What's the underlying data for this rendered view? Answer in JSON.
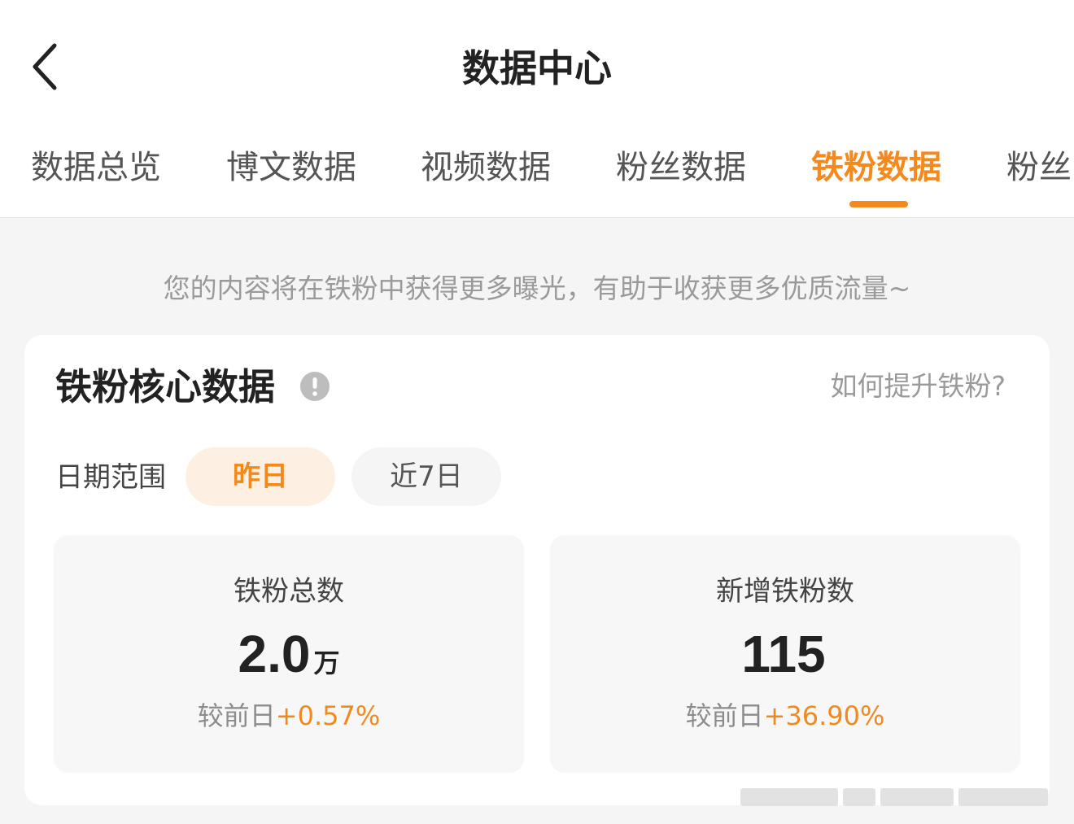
{
  "header": {
    "title": "数据中心",
    "back_icon": "chevron-left-icon"
  },
  "tabs": [
    {
      "label": "数据总览",
      "active": false
    },
    {
      "label": "博文数据",
      "active": false
    },
    {
      "label": "视频数据",
      "active": false
    },
    {
      "label": "粉丝数据",
      "active": false
    },
    {
      "label": "铁粉数据",
      "active": true
    },
    {
      "label": "粉丝",
      "active": false
    }
  ],
  "tip": "您的内容将在铁粉中获得更多曝光，有助于收获更多优质流量~",
  "card": {
    "title": "铁粉核心数据",
    "info_icon": "exclamation-circle-icon",
    "help_link": "如何提升铁粉?",
    "date_range": {
      "label": "日期范围",
      "options": [
        {
          "label": "昨日",
          "selected": true
        },
        {
          "label": "近7日",
          "selected": false
        }
      ]
    },
    "stats": [
      {
        "label": "铁粉总数",
        "value": "2.0",
        "unit": "万",
        "compare_label": "较前日",
        "change": "+0.57%"
      },
      {
        "label": "新增铁粉数",
        "value": "115",
        "unit": "",
        "compare_label": "较前日",
        "change": "+36.90%"
      }
    ]
  },
  "colors": {
    "accent": "#f48a1e",
    "accent_bg": "#fdf0e2",
    "page_bg": "#f5f5f5"
  }
}
